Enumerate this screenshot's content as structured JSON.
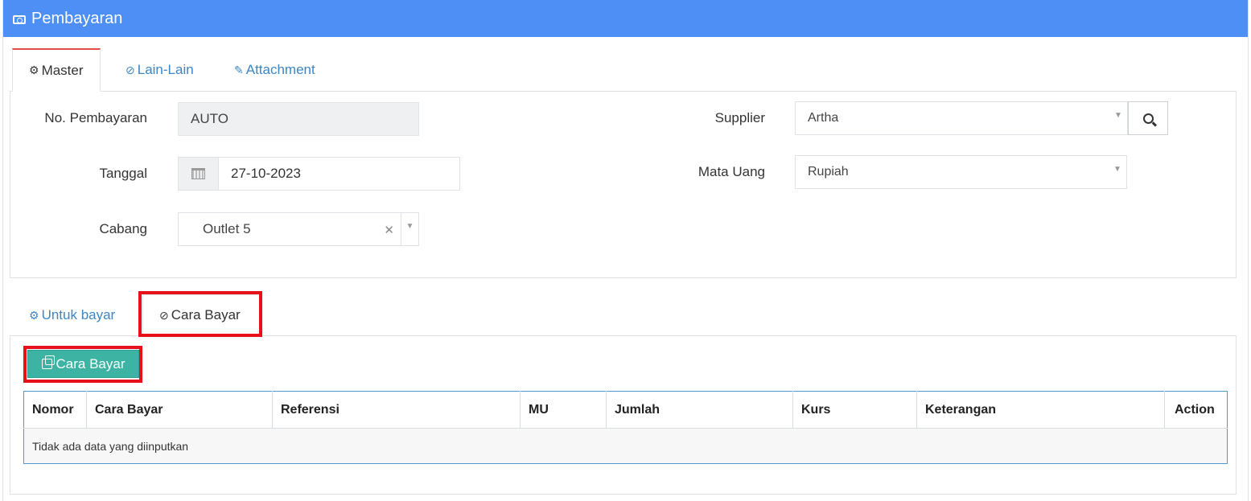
{
  "header": {
    "title": "Pembayaran",
    "icon": "money-icon"
  },
  "top_tabs": [
    {
      "label": "Master",
      "icon": "cogs-icon",
      "active": true
    },
    {
      "label": "Lain-Lain",
      "icon": "check-circle-icon",
      "active": false
    },
    {
      "label": "Attachment",
      "icon": "paperclip-icon",
      "active": false
    }
  ],
  "form": {
    "no_pembayaran": {
      "label": "No. Pembayaran",
      "value": "AUTO"
    },
    "tanggal": {
      "label": "Tanggal",
      "value": "27-10-2023"
    },
    "cabang": {
      "label": "Cabang",
      "value": "Outlet 5"
    },
    "supplier": {
      "label": "Supplier",
      "value": "Artha"
    },
    "mata_uang": {
      "label": "Mata Uang",
      "value": "Rupiah"
    }
  },
  "sub_tabs": [
    {
      "label": "Untuk bayar",
      "icon": "cogs-icon",
      "active": false
    },
    {
      "label": "Cara Bayar",
      "icon": "check-circle-icon",
      "active": true
    }
  ],
  "add_button": {
    "label": "Cara Bayar",
    "icon": "copy-icon"
  },
  "table": {
    "columns": [
      "Nomor",
      "Cara Bayar",
      "Referensi",
      "MU",
      "Jumlah",
      "Kurs",
      "Keterangan",
      "Action"
    ],
    "empty_message": "Tidak ada data yang diinputkan"
  },
  "colors": {
    "header": "#4e8ff5",
    "accent_green": "#3db3a3",
    "highlight_red": "#e8101a",
    "link_blue": "#3c86c4"
  }
}
